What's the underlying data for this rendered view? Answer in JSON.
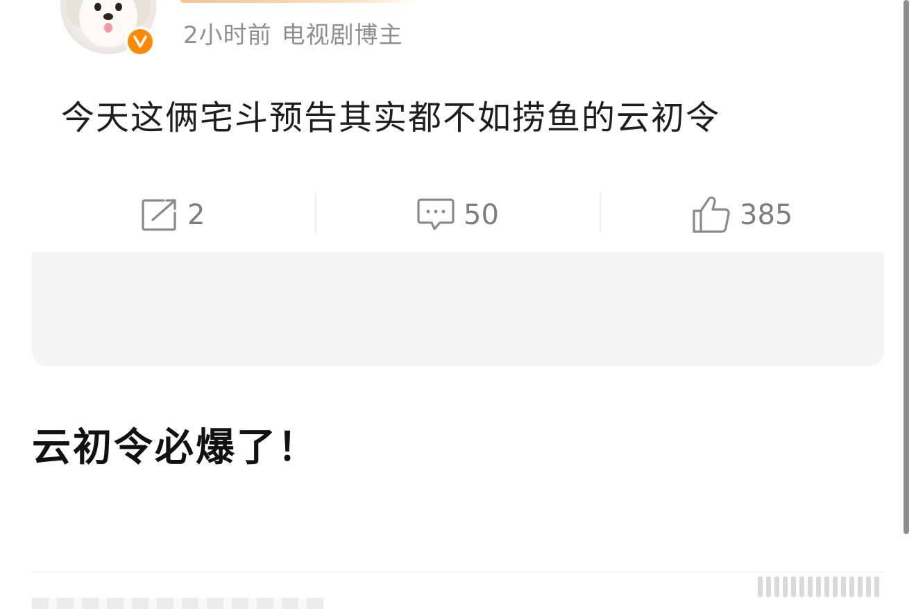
{
  "post": {
    "time": "2小时前",
    "author_tag": "电视剧博主",
    "text": "今天这俩宅斗预告其实都不如捞鱼的云初令",
    "badge_letter": "V",
    "actions": {
      "repost_icon": "share-icon",
      "repost_count": "2",
      "comment_icon": "comment-icon",
      "comment_count": "50",
      "like_icon": "thumbs-up-icon",
      "like_count": "385"
    }
  },
  "headline": "云初令必爆了！",
  "colors": {
    "badge": "#ff8a00",
    "meta_text": "#8f8f8f",
    "count_text": "#7d7d7d",
    "card_gray": "#f4f4f4",
    "scrollbar": "#8e8e8e"
  }
}
